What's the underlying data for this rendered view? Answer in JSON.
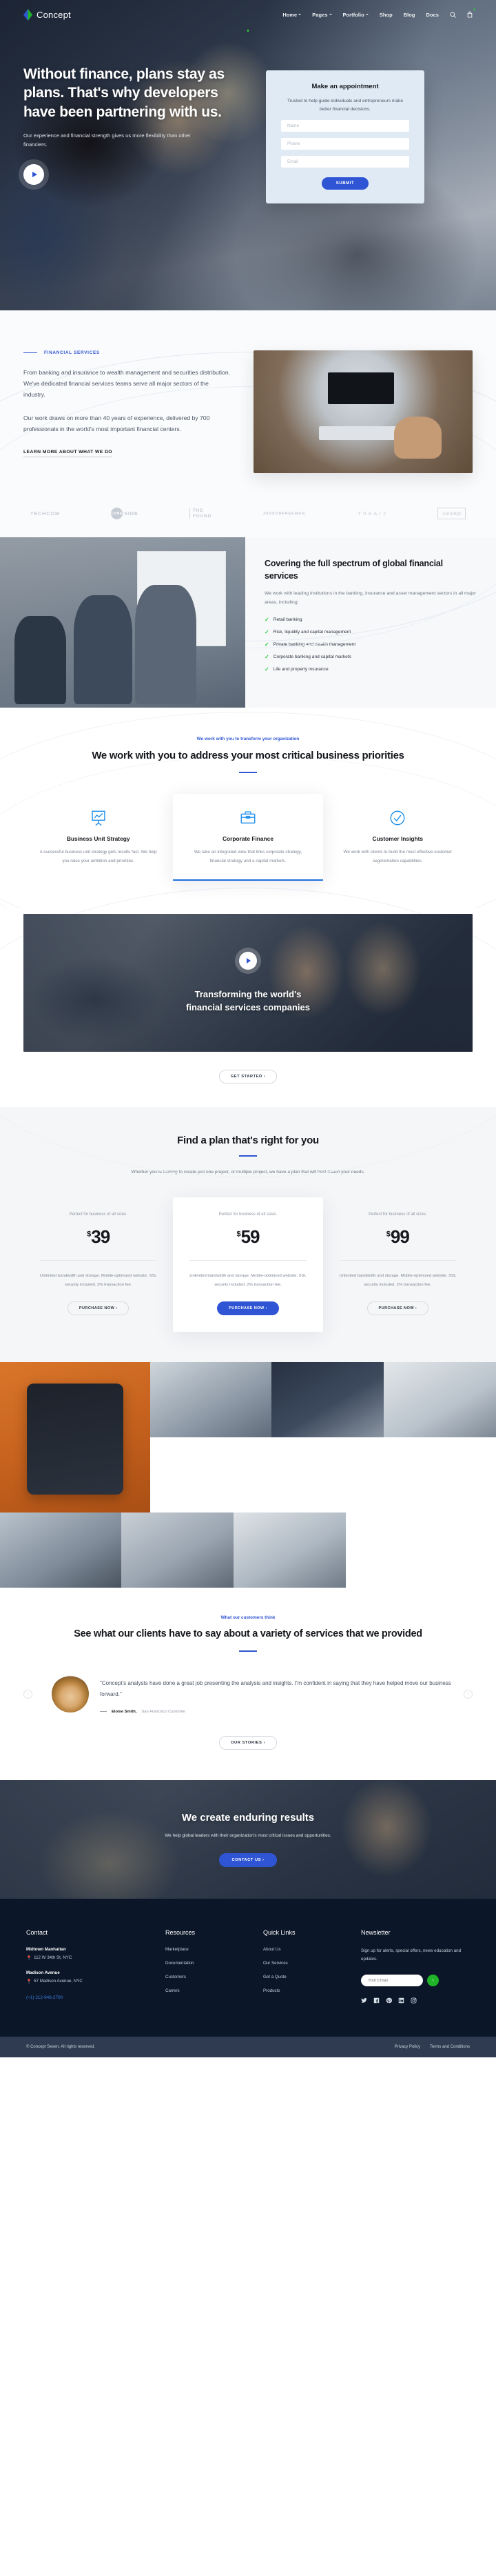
{
  "brand": {
    "name": "Concept",
    "logo_icon": "diamond-logo-icon"
  },
  "nav": {
    "items": [
      {
        "label": "Home",
        "caret": true,
        "active": true
      },
      {
        "label": "Pages",
        "caret": true,
        "active": false
      },
      {
        "label": "Portfolio",
        "caret": true,
        "active": false
      },
      {
        "label": "Shop",
        "caret": false,
        "active": false
      },
      {
        "label": "Blog",
        "caret": false,
        "active": false
      },
      {
        "label": "Docs",
        "caret": false,
        "active": false
      }
    ],
    "search_icon": "search-icon",
    "cart_icon": "shopping-bag-icon",
    "cart_count": "0"
  },
  "hero": {
    "title": "Without finance, plans stay as plans. That's why developers have been partnering with us.",
    "subtitle": "Our experience and financial strength gives us more flexibility than other financiers.",
    "play_icon": "play-button-icon",
    "form": {
      "title": "Make an appointment",
      "description": "Trusted to help guide individuals and entrepreneurs make better financial decisions.",
      "name_placeholder": "Name",
      "phone_placeholder": "Phone",
      "email_placeholder": "Email",
      "submit_label": "SUBMIT"
    }
  },
  "financial": {
    "eyebrow": "FINANCIAL SERVICES",
    "paragraph1": "From banking and insurance to wealth management and securities distribution. We've dedicated financial services teams serve all major sectors of the industry.",
    "paragraph2": "Our work draws on more than 40 years of experience, delivered by 700 professionals in the world's most important financial centers.",
    "link_label": "LEARN MORE ABOUT WHAT WE DO"
  },
  "clients": [
    {
      "type": "text",
      "label": "TECHCOM"
    },
    {
      "type": "oneside",
      "circle": "1ONE",
      "label": "SIDE"
    },
    {
      "type": "found",
      "line1": "THE",
      "line2": "FOUND"
    },
    {
      "type": "text",
      "label": "JUDSONFREEMAN."
    },
    {
      "type": "text",
      "label": "T h e A r c"
    },
    {
      "type": "box",
      "label": "concept"
    }
  ],
  "spectrum": {
    "heading": "Covering the full spectrum of global financial services",
    "description": "We work with leading institutions in the banking, insurance and asset management sectors in all major areas, including:",
    "items": [
      "Retail banking",
      "Risk, liquidity and capital management",
      "Private banking and wealth management",
      "Corporate banking and capital markets",
      "Life and property insurance"
    ]
  },
  "priorities": {
    "kicker": "We work with you to transform your organization",
    "heading": "We work with you to address your most critical business priorities",
    "cards": [
      {
        "icon": "presentation-chart-icon",
        "title": "Business Unit Strategy",
        "text": "A successful business unit strategy gets results fast. We help you raise your ambition and priorities."
      },
      {
        "icon": "briefcase-icon",
        "title": "Corporate Finance",
        "text": "We take an integrated view that links corporate strategy, financial strategy and a capital markets."
      },
      {
        "icon": "check-circle-icon",
        "title": "Customer Insights",
        "text": "We work with clients to build the most effective customer segmentation capabilities."
      }
    ]
  },
  "video": {
    "play_icon": "play-button-icon",
    "heading_line1": "Transforming the world's",
    "heading_line2": "financial services companies",
    "cta_label": "GET STARTED"
  },
  "pricing": {
    "heading": "Find a plan that's right for you",
    "subtitle": "Whether you're looking to create just one project, or multiple project, we have a plan that will best match your needs.",
    "plans": [
      {
        "label": "Perfect for business of all sizes.",
        "currency": "$",
        "price": "39",
        "features": "Unlimited bandwidth and storage. Mobile-optimized website. SSL security included. 2% transaction fee.",
        "button": "PURCHASE NOW",
        "featured": false
      },
      {
        "label": "Perfect for business of all sizes.",
        "currency": "$",
        "price": "59",
        "features": "Unlimited bandwidth and storage. Mobile-optimized website. SSL security included. 2% transaction fee.",
        "button": "PURCHASE NOW",
        "featured": true
      },
      {
        "label": "Perfect for business of all sizes.",
        "currency": "$",
        "price": "99",
        "features": "Unlimited bandwidth and storage. Mobile-optimized website. SSL security included. 2% transaction fee.",
        "button": "PURCHASE NOW",
        "featured": false
      }
    ]
  },
  "testimonial": {
    "kicker": "What our customers think",
    "heading": "See what our clients have to say about a variety of services that we provided",
    "quote": "\"Concept's analysts have done a great job presenting the analysis and insights. I'm confident in saying that they have helped move our business forward.\"",
    "author_name": "Eloise Smith,",
    "author_role": "San Francisco Customer",
    "prev_icon": "chevron-left-icon",
    "next_icon": "chevron-right-icon",
    "cta_label": "OUR STORIES"
  },
  "enduring": {
    "heading": "We create enduring results",
    "paragraph": "We help global leaders with their organization's most critical issues and opportunities.",
    "cta_label": "CONTACT US"
  },
  "footer": {
    "contact": {
      "title": "Contact",
      "addresses": [
        {
          "name": "Midtown Manhattan",
          "line": "112 W 34th St, NYC"
        },
        {
          "name": "Madison Avenue",
          "line": "57 Madison Avenue, NYC"
        }
      ],
      "phone": "(+1) 212-946-2700",
      "pin_icon": "map-pin-icon"
    },
    "resources": {
      "title": "Resources",
      "links": [
        "Marketplace",
        "Documentation",
        "Customers",
        "Carrers"
      ]
    },
    "quick_links": {
      "title": "Quick Links",
      "links": [
        "About Us",
        "Our Services",
        "Get a Quote",
        "Products"
      ]
    },
    "newsletter": {
      "title": "Newsletter",
      "description": "Sign up for alerts, special offers, news education and updates.",
      "email_placeholder": "Your Email",
      "submit_icon": "arrow-right-icon",
      "socials": [
        "twitter-icon",
        "facebook-icon",
        "pinterest-icon",
        "linkedin-icon",
        "instagram-icon"
      ]
    },
    "copyright": "© Concept Seven. All rights reserved.",
    "legal": [
      "Privacy Policy",
      "Terms and Conditions"
    ]
  },
  "colors": {
    "brand_blue": "#2f55d4",
    "accent_green": "#2ecc40",
    "footer_dark": "#0b1628",
    "subfooter": "#2e3b50"
  }
}
